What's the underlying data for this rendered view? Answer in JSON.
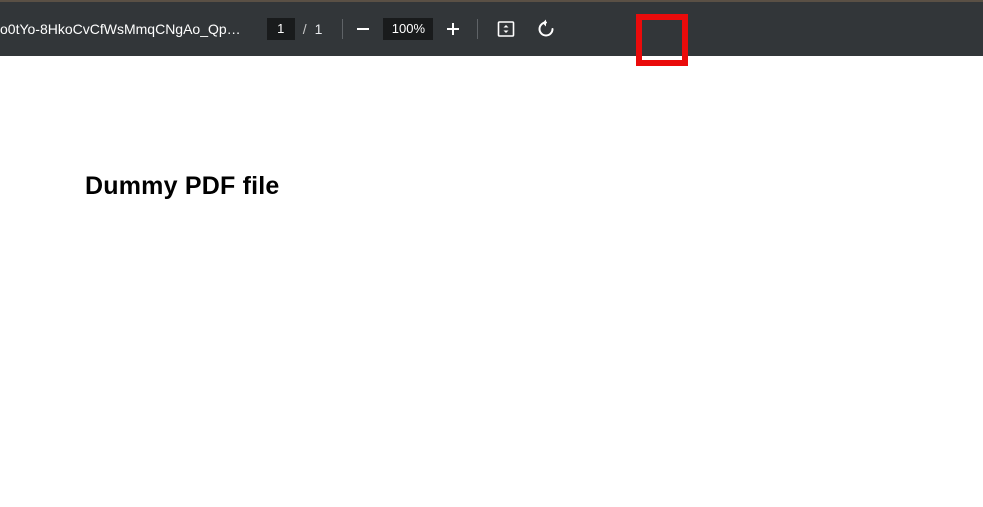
{
  "toolbar": {
    "title": "o0tYo-8HkoCvCfWsMmqCNgAo_Qp…",
    "page_current": "1",
    "page_separator": "/",
    "page_total": "1",
    "zoom_level": "100%"
  },
  "document": {
    "heading": "Dummy PDF file"
  },
  "icons": {
    "zoom_out": "minus-icon",
    "zoom_in": "plus-icon",
    "fit": "fit-to-page-icon",
    "rotate": "rotate-ccw-icon"
  },
  "annotation": {
    "highlight_target": "rotate-button"
  }
}
